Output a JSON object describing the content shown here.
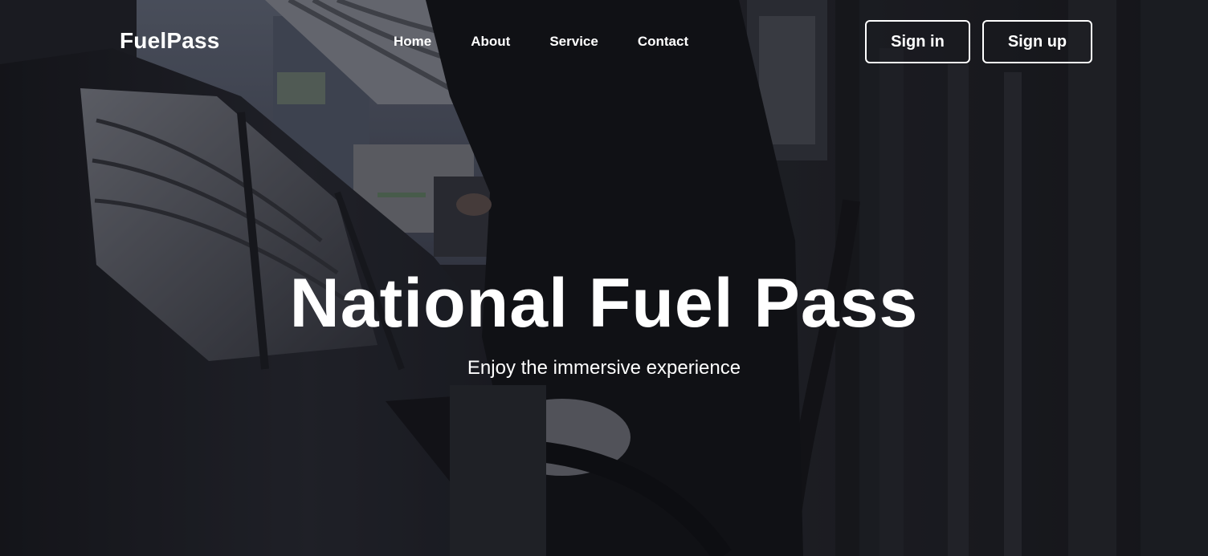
{
  "header": {
    "brand": "FuelPass",
    "nav": [
      {
        "label": "Home"
      },
      {
        "label": "About"
      },
      {
        "label": "Service"
      },
      {
        "label": "Contact"
      }
    ],
    "signin_label": "Sign in",
    "signup_label": "Sign up"
  },
  "hero": {
    "title": "National Fuel Pass",
    "subtitle": "Enjoy the immersive experience",
    "background_icon": "fuel-station-photo"
  },
  "colors": {
    "text": "#ffffff",
    "overlay": "#0a0b10",
    "background": "#1b1c20"
  }
}
